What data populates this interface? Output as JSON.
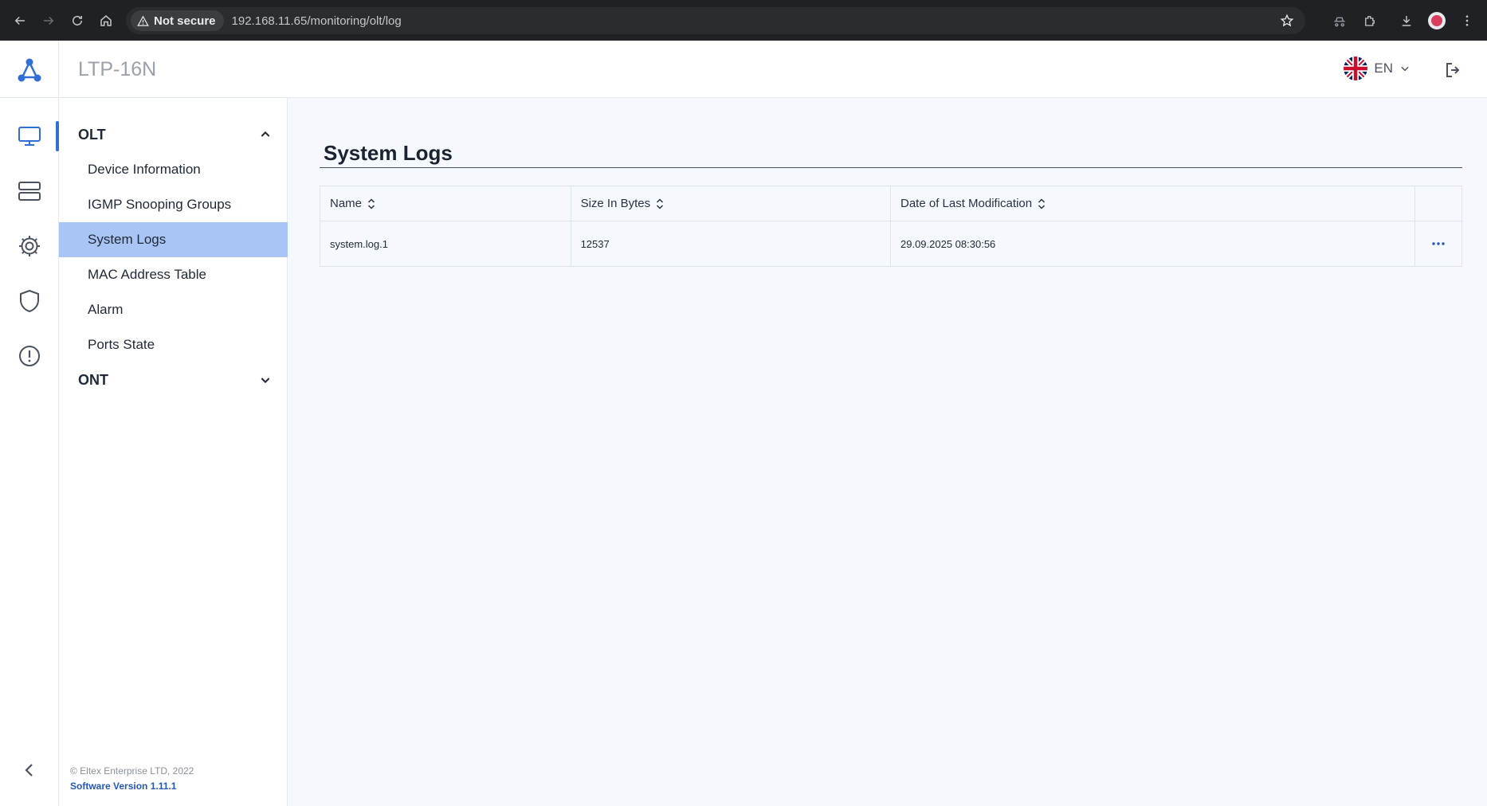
{
  "browser": {
    "security_label": "Not secure",
    "url": "192.168.11.65/monitoring/olt/log"
  },
  "header": {
    "app_title": "LTP-16N",
    "language": "EN"
  },
  "submenu": {
    "groups": [
      {
        "label": "OLT",
        "expanded": true,
        "items": [
          {
            "label": "Device Information"
          },
          {
            "label": "IGMP Snooping Groups"
          },
          {
            "label": "System Logs",
            "active": true
          },
          {
            "label": "MAC Address Table"
          },
          {
            "label": "Alarm"
          },
          {
            "label": "Ports State"
          }
        ]
      },
      {
        "label": "ONT",
        "expanded": false
      }
    ],
    "footer": {
      "copyright": "© Eltex Enterprise LTD, 2022",
      "version": "Software Version 1.11.1"
    }
  },
  "main": {
    "title": "System Logs",
    "table": {
      "columns": [
        "Name",
        "Size In Bytes",
        "Date of Last Modification"
      ],
      "rows": [
        {
          "name": "system.log.1",
          "size": "12537",
          "modified": "29.09.2025 08:30:56"
        }
      ]
    }
  },
  "colors": {
    "accent": "#2f6fd6",
    "active_menu": "#a9c5f5",
    "background": "#f5f8fd"
  }
}
